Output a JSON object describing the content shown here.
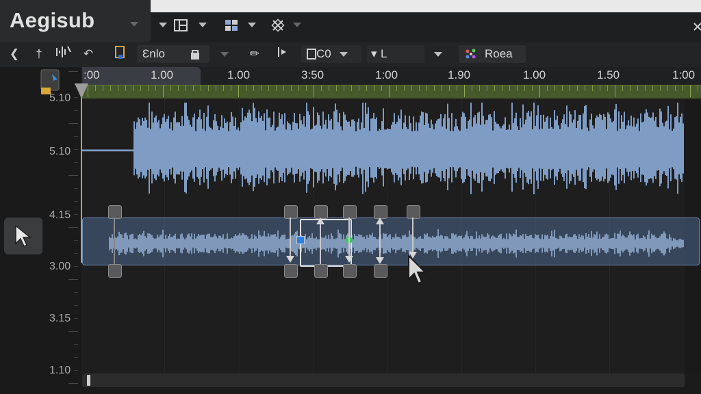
{
  "app": {
    "title": "Aegisub"
  },
  "titlebar": {
    "icons": [
      "layout-icon",
      "grid-icon",
      "tools-icon"
    ]
  },
  "toolbar": {
    "style_field": "Ɛnlo",
    "time_field": "C0",
    "layer_field": "L",
    "font_button_label": "Roea"
  },
  "timeline": {
    "labels": [
      ":00",
      "1.00",
      "1.00",
      "3:50",
      "1:00",
      "1.90",
      "1.00",
      "1.50",
      "1:00"
    ]
  },
  "vruler": {
    "labels": [
      "5.10",
      "5.10",
      "4.15",
      "3.00",
      "3.15",
      "1.10"
    ]
  },
  "colors": {
    "waveform": "#7f9dc4",
    "selection": "#4d688c",
    "green_bar": "#45592b",
    "playhead": "#c8a92a"
  },
  "scroll": {
    "position_fraction": 0.01
  }
}
